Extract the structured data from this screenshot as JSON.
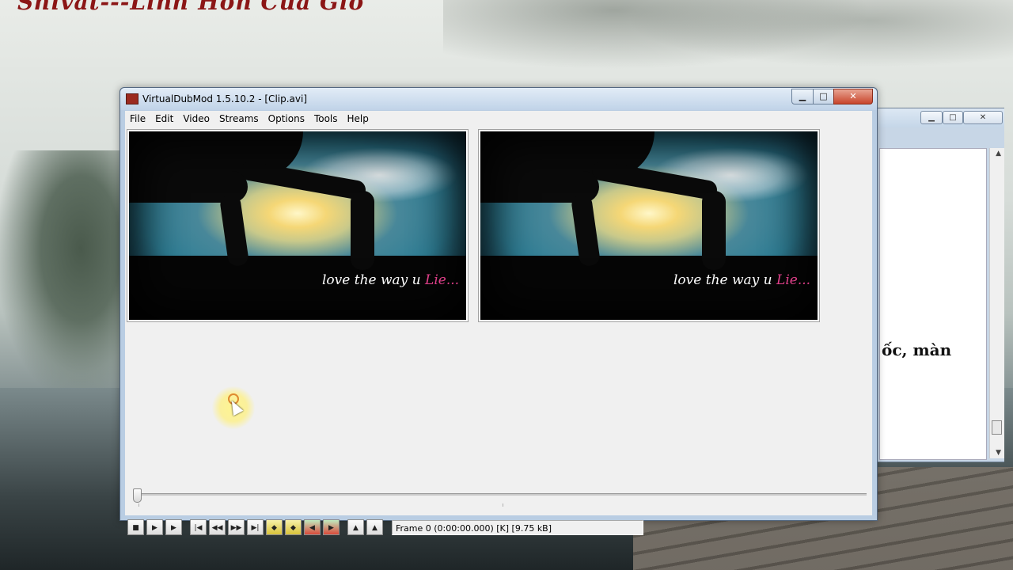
{
  "desktop": {
    "title": "Shivat---Linh Hồn Của Gió"
  },
  "background_window": {
    "doc_text": "ốc, màn"
  },
  "window": {
    "title": "VirtualDubMod 1.5.10.2 - [Clip.avi]"
  },
  "menu": {
    "items": [
      "File",
      "Edit",
      "Video",
      "Streams",
      "Options",
      "Tools",
      "Help"
    ]
  },
  "panes": {
    "caption_white_1": "love the way u ",
    "caption_pink": "Lie..."
  },
  "timeline": {
    "position": 0
  },
  "status": {
    "frame": "Frame 0 (0:00:00.000) [K] [9.75 kB]"
  },
  "colors": {
    "titlebar": "#c0d3e8",
    "close": "#c8452b",
    "client": "#f0f0f0",
    "caption_pink": "#e0408a"
  }
}
